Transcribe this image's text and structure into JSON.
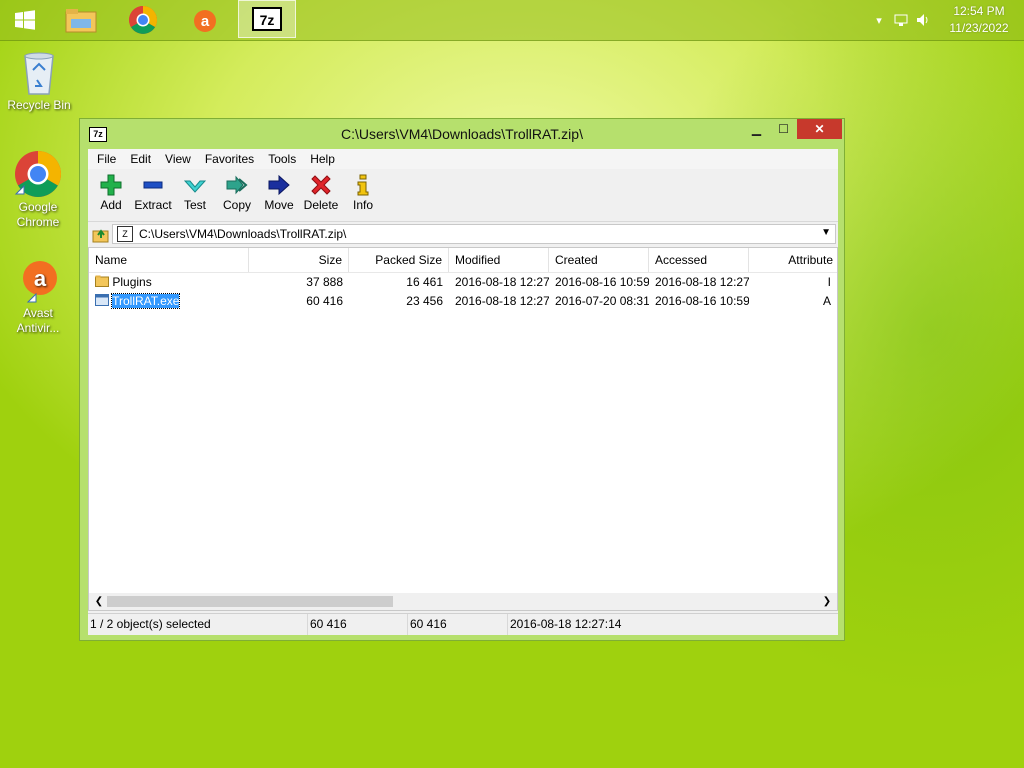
{
  "taskbar": {
    "apps": [
      "File Explorer",
      "Google Chrome",
      "Avast",
      "7-Zip"
    ],
    "clock": {
      "time": "12:54 PM",
      "date": "11/23/2022"
    }
  },
  "desktop": {
    "icons": [
      {
        "label": "Recycle Bin"
      },
      {
        "label": "Google Chrome"
      },
      {
        "label": "Avast Antivir..."
      }
    ]
  },
  "window": {
    "title": "C:\\Users\\VM4\\Downloads\\TrollRAT.zip\\",
    "menu": [
      "File",
      "Edit",
      "View",
      "Favorites",
      "Tools",
      "Help"
    ],
    "toolbar": [
      {
        "label": "Add",
        "icon": "plus-icon"
      },
      {
        "label": "Extract",
        "icon": "minus-icon"
      },
      {
        "label": "Test",
        "icon": "check-icon"
      },
      {
        "label": "Copy",
        "icon": "double-arrow-icon"
      },
      {
        "label": "Move",
        "icon": "arrow-right-icon"
      },
      {
        "label": "Delete",
        "icon": "x-icon"
      },
      {
        "label": "Info",
        "icon": "info-icon"
      }
    ],
    "address": "C:\\Users\\VM4\\Downloads\\TrollRAT.zip\\",
    "columns": [
      "Name",
      "Size",
      "Packed Size",
      "Modified",
      "Created",
      "Accessed",
      "Attribute"
    ],
    "rows": [
      {
        "name": "Plugins",
        "size": "37 888",
        "packed": "16 461",
        "modified": "2016-08-18 12:27",
        "created": "2016-08-16 10:59",
        "accessed": "2016-08-18 12:27",
        "attr": "I",
        "type": "folder"
      },
      {
        "name": "TrollRAT.exe",
        "size": "60 416",
        "packed": "23 456",
        "modified": "2016-08-18 12:27",
        "created": "2016-07-20 08:31",
        "accessed": "2016-08-16 10:59",
        "attr": "A",
        "type": "exe",
        "selected": true
      }
    ],
    "status": {
      "selection": "1 / 2 object(s) selected",
      "size": "60 416",
      "size2": "60 416",
      "modified": "2016-08-18 12:27:14"
    }
  },
  "colors": {
    "accent": "#3399ff",
    "close": "#c7392c",
    "frame": "#b6e06d"
  }
}
